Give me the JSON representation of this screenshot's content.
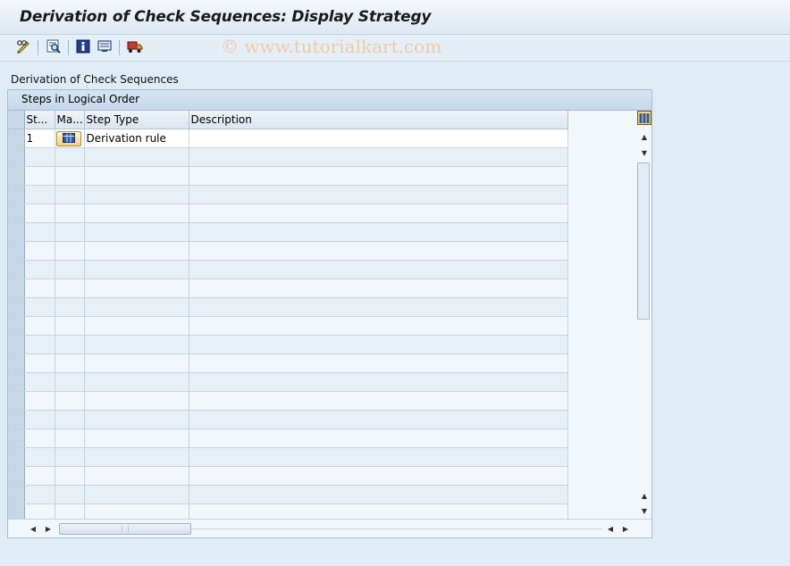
{
  "window": {
    "title": "Derivation of Check Sequences: Display Strategy"
  },
  "toolbar": {
    "buttons": [
      {
        "id": "change",
        "icon": "pencil-glasses-icon"
      },
      {
        "id": "find",
        "icon": "find-icon"
      },
      {
        "id": "info",
        "icon": "info-icon"
      },
      {
        "id": "display",
        "icon": "display-screen-icon"
      },
      {
        "id": "transport",
        "icon": "truck-icon"
      }
    ]
  },
  "watermark": "© www.tutorialkart.com",
  "section": {
    "label": "Derivation of Check Sequences"
  },
  "panel": {
    "title": "Steps in Logical Order",
    "columns": [
      "St...",
      "Ma...",
      "Step Type",
      "Description"
    ],
    "rows": [
      {
        "step": "1",
        "step_type": "Derivation rule",
        "description": "",
        "has_maintain_button": true
      }
    ],
    "total_visible_rows": 21
  },
  "colors": {
    "background": "#dfebf5",
    "header": "#c5d8ea",
    "button_accent": "#f3d27a"
  }
}
